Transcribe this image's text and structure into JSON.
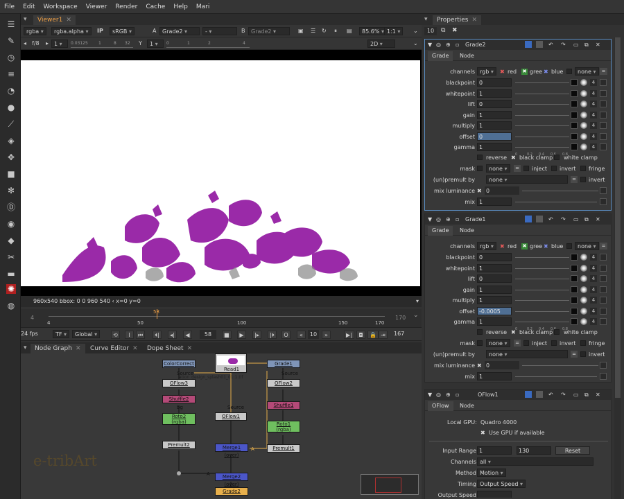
{
  "menu": [
    "File",
    "Edit",
    "Workspace",
    "Viewer",
    "Render",
    "Cache",
    "Help",
    "Mari"
  ],
  "viewer": {
    "tab": "Viewer1",
    "row1": {
      "channels": "rgba",
      "alpha": "rgba.alpha",
      "ip": "IP",
      "colorspace": "sRGB",
      "a_label": "A",
      "a_input": "Grade2",
      "a_op": "-",
      "b_label": "B",
      "b_input": "Grade2",
      "zoom": "85.6%",
      "ratio": "1:1"
    },
    "row2": {
      "fstop": "f/8",
      "gain": "1",
      "y_label": "Y",
      "gamma": "1",
      "mode": "2D"
    },
    "gain_ticks": [
      "0.03125",
      "1",
      "8",
      "32"
    ],
    "gamma_ticks": [
      "0",
      "1",
      "2",
      "4"
    ],
    "info": "960x540  bbox: 0 0 960 540 ‹ x=0 y=0",
    "timeline": {
      "in": "4",
      "out": "170",
      "ticks": [
        "4",
        "50",
        "100",
        "150",
        "170"
      ],
      "current": "58"
    },
    "playbar": {
      "fps": "24 fps",
      "tf": "TF",
      "mode": "Global",
      "frame": "58",
      "step": "10",
      "end": "167"
    }
  },
  "nodegraph": {
    "tabs": [
      "Node Graph",
      "Curve Editor",
      "Dope Sheet"
    ],
    "watermark": "e-tribArt",
    "nodes": [
      {
        "id": "colorcorrect",
        "label": "ColorCorrect",
        "color": "#7f95b8"
      },
      {
        "id": "oflow3",
        "label": "OFlow3",
        "color": "#c8c8c8"
      },
      {
        "id": "shuffle2",
        "label": "Shuffle2",
        "color": "#b44a78"
      },
      {
        "id": "roto2",
        "label": "Roto2\n(rgba)",
        "color": "#6fbf5f"
      },
      {
        "id": "premult2",
        "label": "Premult2",
        "color": "#c8c8c8"
      },
      {
        "id": "read1",
        "label": "Read1",
        "color": "#c8c8c8"
      },
      {
        "id": "oflow1",
        "label": "OFlow1",
        "color": "#c8c8c8"
      },
      {
        "id": "merge1",
        "label": "Merge1 (over)",
        "color": "#4b56c8"
      },
      {
        "id": "merge2",
        "label": "Merge2 (over)",
        "color": "#4b56c8"
      },
      {
        "id": "grade2",
        "label": "Grade2",
        "color": "#e8b04c"
      },
      {
        "id": "grade1",
        "label": "Grade1",
        "color": "#7f95b8"
      },
      {
        "id": "oflow2",
        "label": "OFlow2",
        "color": "#c8c8c8"
      },
      {
        "id": "shuffle1",
        "label": "Shuffle1",
        "color": "#b44a78"
      },
      {
        "id": "roto1",
        "label": "Roto1\n(rgba)",
        "color": "#6fbf5f"
      },
      {
        "id": "premult1",
        "label": "Premult1",
        "color": "#c8c8c8"
      }
    ],
    "read_file": "ation_design_splash01_01:1.tif",
    "labels": {
      "source1": "Source",
      "source2": "Source",
      "source3": "Source",
      "bg": "bg",
      "a1": "A",
      "a2": "A"
    }
  },
  "properties": {
    "tab": "Properties",
    "max_panels": "10",
    "grade_panels": [
      {
        "name": "Grade2",
        "tabs": [
          "Grade",
          "Node"
        ],
        "channels": "rgb",
        "channel_labels": [
          "red",
          "gree",
          "blue"
        ],
        "channel_none": "none",
        "params": [
          {
            "label": "blackpoint",
            "value": "0"
          },
          {
            "label": "whitepoint",
            "value": "1"
          },
          {
            "label": "lift",
            "value": "0"
          },
          {
            "label": "gain",
            "value": "1"
          },
          {
            "label": "multiply",
            "value": "1"
          },
          {
            "label": "offset",
            "value": "0"
          },
          {
            "label": "gamma",
            "value": "1"
          }
        ],
        "reverse": "reverse",
        "black_clamp": "black clamp",
        "white_clamp": "white clamp",
        "mask_label": "mask",
        "mask_value": "none",
        "inject": "inject",
        "invert": "invert",
        "fringe": "fringe",
        "unpremult_label": "(un)premult by",
        "unpremult_value": "none",
        "invert2": "invert",
        "mixlum_label": "mix luminance",
        "mixlum_value": "0",
        "mix_label": "mix",
        "mix_value": "1",
        "slider_ticks": [
          "0",
          "0.2",
          "0.4",
          "0.6",
          "0.8"
        ],
        "num": "4"
      },
      {
        "name": "Grade1",
        "tabs": [
          "Grade",
          "Node"
        ],
        "channels": "rgb",
        "channel_labels": [
          "red",
          "gree",
          "blue"
        ],
        "channel_none": "none",
        "params": [
          {
            "label": "blackpoint",
            "value": "0"
          },
          {
            "label": "whitepoint",
            "value": "1"
          },
          {
            "label": "lift",
            "value": "0"
          },
          {
            "label": "gain",
            "value": "1"
          },
          {
            "label": "multiply",
            "value": "1"
          },
          {
            "label": "offset",
            "value": "-0.0005"
          },
          {
            "label": "gamma",
            "value": "1"
          }
        ],
        "reverse": "reverse",
        "black_clamp": "black clamp",
        "white_clamp": "white clamp",
        "mask_label": "mask",
        "mask_value": "none",
        "inject": "inject",
        "invert": "invert",
        "fringe": "fringe",
        "unpremult_label": "(un)premult by",
        "unpremult_value": "none",
        "invert2": "invert",
        "mixlum_label": "mix luminance",
        "mixlum_value": "0",
        "mix_label": "mix",
        "mix_value": "1",
        "slider_ticks": [
          "0",
          "0.2",
          "0.4",
          "0.6",
          "0.8"
        ],
        "num": "4"
      }
    ],
    "oflow": {
      "name": "OFlow1",
      "tabs": [
        "OFlow",
        "Node"
      ],
      "gpu_label": "Local GPU:",
      "gpu_value": "Quadro 4000",
      "use_gpu": "Use GPU if available",
      "input_range_label": "Input Range",
      "range_start": "1",
      "range_end": "130",
      "reset": "Reset",
      "channels_label": "Channels",
      "channels_value": "all",
      "method_label": "Method",
      "method_value": "Motion",
      "timing_label": "Timing",
      "timing_value": "Output Speed",
      "output_speed_label": "Output Speed"
    }
  },
  "colors": {
    "accent": "#f0a045",
    "selection": "#5b8fc6",
    "splash": "#9a2aa8"
  }
}
